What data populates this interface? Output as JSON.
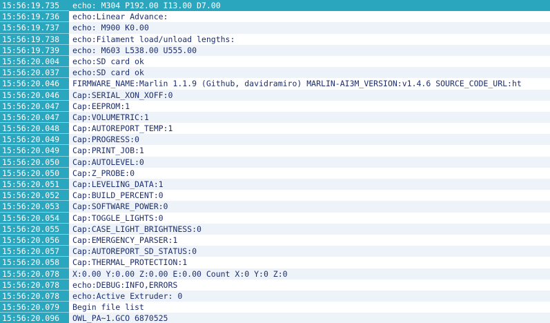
{
  "console": {
    "selected_index": 0,
    "lines": [
      {
        "time": "15:56:19.735",
        "text": "echo:  M304 P192.00 I13.00 D7.00"
      },
      {
        "time": "15:56:19.736",
        "text": "echo:Linear Advance:"
      },
      {
        "time": "15:56:19.737",
        "text": "echo:  M900 K0.00"
      },
      {
        "time": "15:56:19.738",
        "text": "echo:Filament load/unload lengths:"
      },
      {
        "time": "15:56:19.739",
        "text": "echo:  M603 L538.00 U555.00"
      },
      {
        "time": "15:56:20.004",
        "text": "echo:SD card ok"
      },
      {
        "time": "15:56:20.037",
        "text": "echo:SD card ok"
      },
      {
        "time": "15:56:20.046",
        "text": "FIRMWARE_NAME:Marlin 1.1.9 (Github, davidramiro) MARLIN-AI3M_VERSION:v1.4.6 SOURCE_CODE_URL:ht"
      },
      {
        "time": "15:56:20.046",
        "text": "Cap:SERIAL_XON_XOFF:0"
      },
      {
        "time": "15:56:20.047",
        "text": "Cap:EEPROM:1"
      },
      {
        "time": "15:56:20.047",
        "text": "Cap:VOLUMETRIC:1"
      },
      {
        "time": "15:56:20.048",
        "text": "Cap:AUTOREPORT_TEMP:1"
      },
      {
        "time": "15:56:20.049",
        "text": "Cap:PROGRESS:0"
      },
      {
        "time": "15:56:20.049",
        "text": "Cap:PRINT_JOB:1"
      },
      {
        "time": "15:56:20.050",
        "text": "Cap:AUTOLEVEL:0"
      },
      {
        "time": "15:56:20.050",
        "text": "Cap:Z_PROBE:0"
      },
      {
        "time": "15:56:20.051",
        "text": "Cap:LEVELING_DATA:1"
      },
      {
        "time": "15:56:20.052",
        "text": "Cap:BUILD_PERCENT:0"
      },
      {
        "time": "15:56:20.053",
        "text": "Cap:SOFTWARE_POWER:0"
      },
      {
        "time": "15:56:20.054",
        "text": "Cap:TOGGLE_LIGHTS:0"
      },
      {
        "time": "15:56:20.055",
        "text": "Cap:CASE_LIGHT_BRIGHTNESS:0"
      },
      {
        "time": "15:56:20.056",
        "text": "Cap:EMERGENCY_PARSER:1"
      },
      {
        "time": "15:56:20.057",
        "text": "Cap:AUTOREPORT_SD_STATUS:0"
      },
      {
        "time": "15:56:20.058",
        "text": "Cap:THERMAL_PROTECTION:1"
      },
      {
        "time": "15:56:20.078",
        "text": "X:0.00 Y:0.00 Z:0.00 E:0.00 Count X:0 Y:0 Z:0"
      },
      {
        "time": "15:56:20.078",
        "text": "echo:DEBUG:INFO,ERRORS"
      },
      {
        "time": "15:56:20.078",
        "text": "echo:Active Extruder: 0"
      },
      {
        "time": "15:56:20.079",
        "text": "Begin file list"
      },
      {
        "time": "15:56:20.096",
        "text": "OWL_PA~1.GCO 6870525"
      }
    ]
  }
}
